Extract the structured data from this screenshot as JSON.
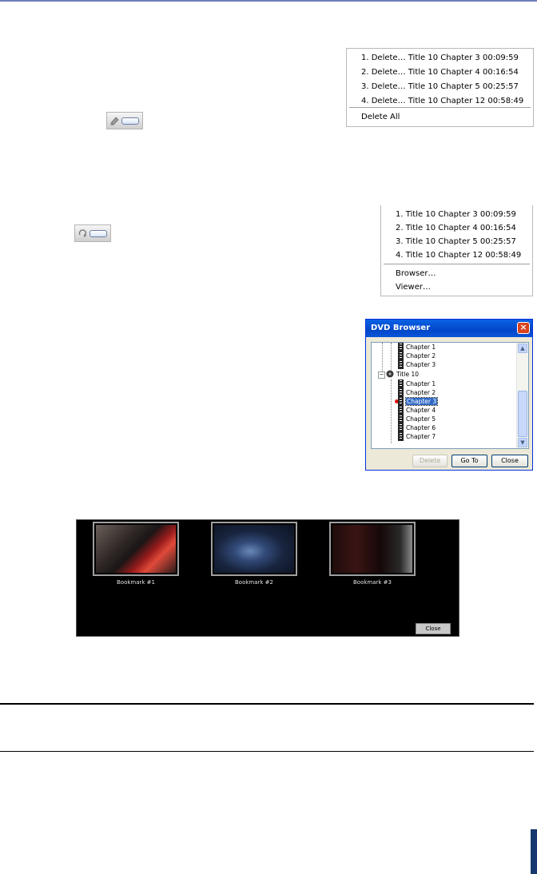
{
  "delete_menu": {
    "items": [
      "1. Delete… Title 10 Chapter 3 00:09:59",
      "2. Delete… Title 10 Chapter 4 00:16:54",
      "3. Delete… Title 10 Chapter 5 00:25:57",
      "4. Delete… Title 10 Chapter 12 00:58:49"
    ],
    "delete_all": "Delete All"
  },
  "goto_menu": {
    "items": [
      "1. Title 10 Chapter 3 00:09:59",
      "2. Title 10 Chapter 4 00:16:54",
      "3. Title 10 Chapter 5 00:25:57",
      "4. Title 10 Chapter 12 00:58:49"
    ],
    "browser": "Browser…",
    "viewer": "Viewer…"
  },
  "dvd_browser": {
    "title": "DVD Browser",
    "tree_prev_chapters": [
      "Chapter 1",
      "Chapter 2",
      "Chapter 3"
    ],
    "title_node": "Title 10",
    "chapters": [
      "Chapter 1",
      "Chapter 2",
      "Chapter 3",
      "Chapter 4",
      "Chapter 5",
      "Chapter 6",
      "Chapter 7"
    ],
    "selected_chapter": "Chapter 3",
    "buttons": {
      "delete": "Delete",
      "goto": "Go To",
      "close": "Close"
    }
  },
  "viewer": {
    "bookmarks": [
      "Bookmark #1",
      "Bookmark #2",
      "Bookmark #3"
    ],
    "close": "Close"
  },
  "icons": {
    "delete_bookmark_button": "delete-bookmark-icon",
    "goto_bookmark_button": "goto-bookmark-icon"
  }
}
